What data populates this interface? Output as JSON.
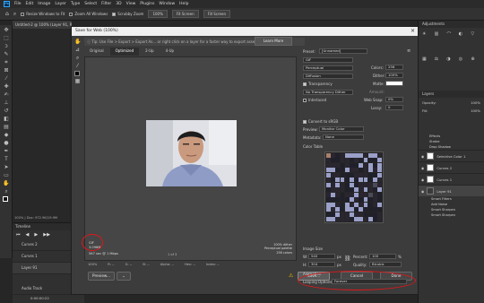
{
  "menubar": {
    "items": [
      "File",
      "Edit",
      "Image",
      "Layer",
      "Type",
      "Select",
      "Filter",
      "3D",
      "View",
      "Plugins",
      "Window",
      "Help"
    ]
  },
  "optionsbar": {
    "resize_windows": "Resize Windows to Fit",
    "zoom_all": "Zoom All Windows",
    "scrubby_zoom": "Scrubby Zoom",
    "zoom_pct": "100%",
    "fit_screen": "Fit Screen",
    "fill_screen": "Fill Screen"
  },
  "document": {
    "tab_title": "Untitled-2 @ 100% (Layer 91, RGB/8)",
    "status": "100% | Doc: 972.9K/19.9M"
  },
  "dialog": {
    "title": "Save for Web (100%)",
    "tip": "Tip: Use File > Export > Export As... or right click on a layer for a faster way to export assets.",
    "learn_more": "Learn More",
    "tabs": [
      "Original",
      "Optimized",
      "2-Up",
      "4-Up"
    ],
    "active_tab": "Optimized",
    "preview_format": "GIF",
    "preview_size": "3.096M",
    "preview_time": "567 sec @ 1 Mbps",
    "preview_right": [
      "100% dither",
      "Perceptual palette",
      "256 colors"
    ],
    "zoom": "100%",
    "bottom_labels": [
      "R: --",
      "G: --",
      "B: --",
      "Alpha: --",
      "Hex: --",
      "Index: --"
    ],
    "buttons": {
      "preview": "Preview...",
      "save": "Save...",
      "cancel": "Cancel",
      "done": "Done"
    }
  },
  "settings": {
    "preset_label": "Preset:",
    "preset_value": "[Unnamed]",
    "format": "GIF",
    "reduction": "Perceptual",
    "dither_algo": "Diffusion",
    "colors_label": "Colors:",
    "colors_value": "256",
    "dither_label": "Dither:",
    "dither_value": "100%",
    "transparency_label": "Transparency",
    "matte_label": "Matte:",
    "trans_dither": "No Transparency Dither",
    "amount_label": "Amount:",
    "interlaced_label": "Interlaced",
    "websnap_label": "Web Snap:",
    "websnap_value": "0%",
    "lossy_label": "Lossy:",
    "lossy_value": "0",
    "convert_srgb": "Convert to sRGB",
    "preview_label": "Preview:",
    "preview_value": "Monitor Color",
    "metadata_label": "Metadata:",
    "metadata_value": "None",
    "color_table_label": "Color Table",
    "image_size_label": "Image Size",
    "w_label": "W:",
    "w_value": "540",
    "h_label": "H:",
    "h_value": "304",
    "px_unit": "px",
    "percent_label": "Percent:",
    "percent_value": "100",
    "pct_unit": "%",
    "quality_label": "Quality:",
    "quality_value": "Bicubic",
    "animation_label": "Animation",
    "looping_label": "Looping Options:",
    "looping_value": "Forever",
    "frame_counter": "1 of 3"
  },
  "timeline": {
    "title": "Timeline",
    "tracks": [
      "Curves 2",
      "Curves 1",
      "Layer 91"
    ],
    "audio": "Audio Track",
    "timecode": "0:00:00:22"
  },
  "right_panel": {
    "tab": "Adjustments",
    "layers_tab": "Layers",
    "opacity_label": "Opacity:",
    "opacity_value": "100%",
    "fill_label": "Fill:",
    "fill_value": "100%",
    "effects": [
      "Effects",
      "Stroke",
      "Drop Shadow"
    ],
    "layers": [
      "Selective Color 1",
      "Curves 2",
      "Curves 1",
      "Layer 91",
      "Smart Filters",
      "Add Noise",
      "Smart Sharpen",
      "Smart Sharpen"
    ]
  },
  "colors": {
    "annotation": "#e0161a",
    "dialog_bg": "#3c3c3c",
    "app_bg": "#262626"
  }
}
